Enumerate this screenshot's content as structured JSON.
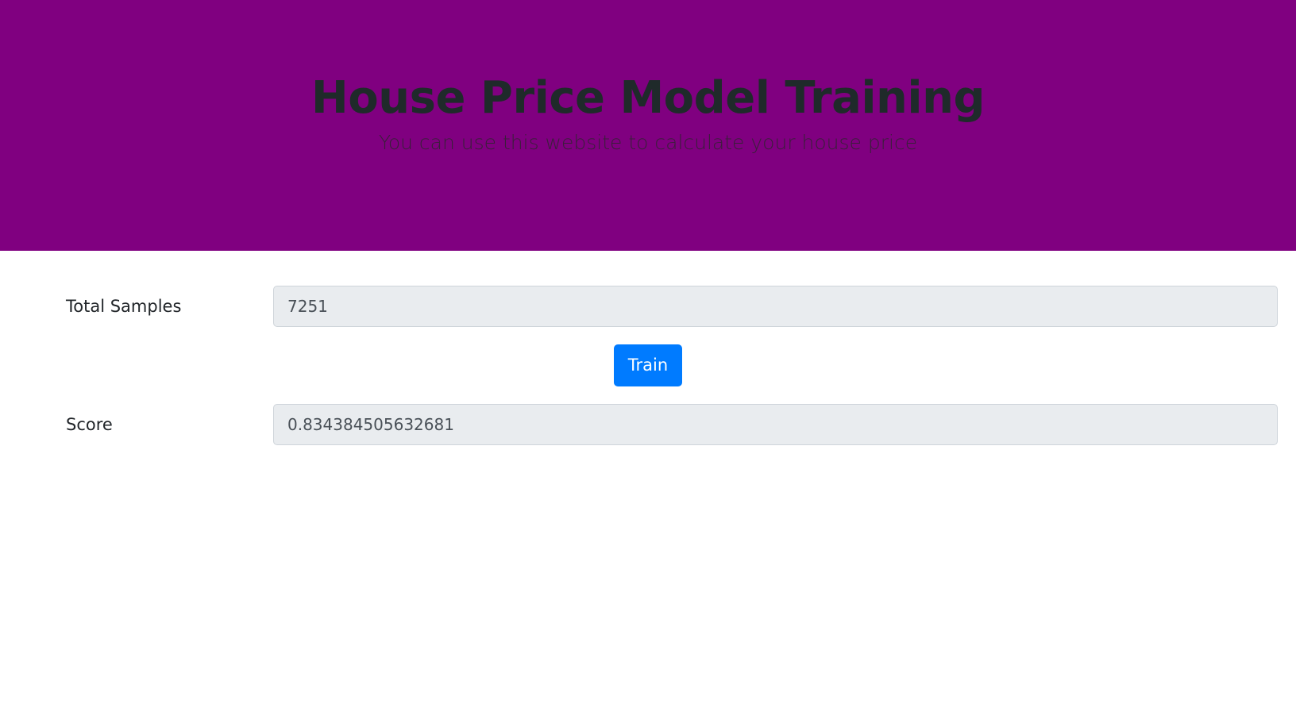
{
  "header": {
    "title": "House Price Model Training",
    "subtitle": "You can use this website to calculate your house price"
  },
  "form": {
    "total_samples": {
      "label": "Total Samples",
      "value": "7251"
    },
    "train_button": {
      "label": "Train"
    },
    "score": {
      "label": "Score",
      "value": "0.834384505632681"
    }
  },
  "colors": {
    "hero_background": "#800080",
    "button_primary": "#007bff",
    "readonly_field": "#e9ecef"
  }
}
